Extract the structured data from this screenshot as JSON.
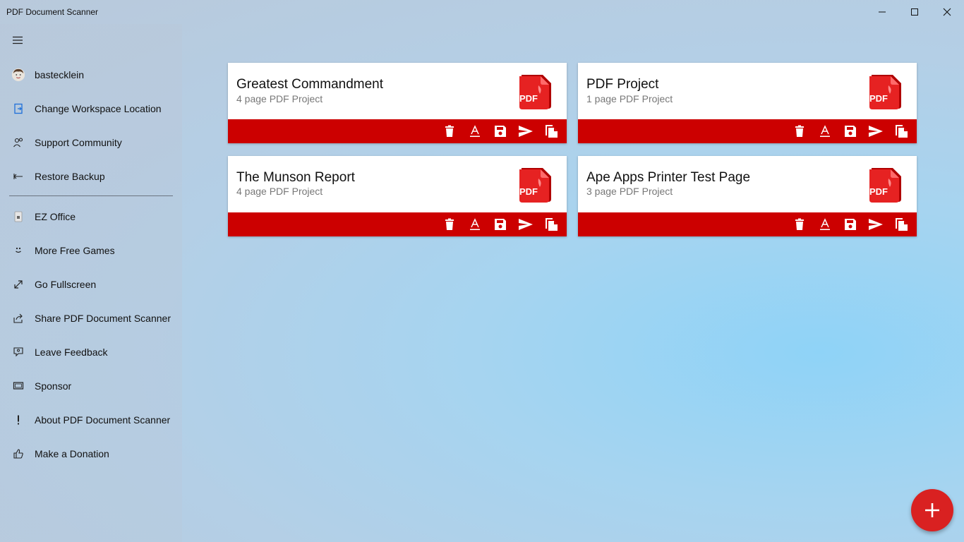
{
  "window": {
    "title": "PDF Document Scanner"
  },
  "sidebar": {
    "items": [
      {
        "label": "bastecklein",
        "icon": "avatar"
      },
      {
        "label": "Change Workspace Location",
        "icon": "folder-icon"
      },
      {
        "label": "Support Community",
        "icon": "community-icon"
      },
      {
        "label": "Restore Backup",
        "icon": "restore-icon"
      },
      {
        "label": "EZ Office",
        "icon": "ez-office-icon"
      },
      {
        "label": "More Free Games",
        "icon": "smiley-icon"
      },
      {
        "label": "Go Fullscreen",
        "icon": "fullscreen-icon"
      },
      {
        "label": "Share PDF Document Scanner",
        "icon": "share-icon"
      },
      {
        "label": "Leave Feedback",
        "icon": "feedback-icon"
      },
      {
        "label": "Sponsor",
        "icon": "sponsor-icon"
      },
      {
        "label": "About PDF Document Scanner",
        "icon": "info-icon"
      },
      {
        "label": "Make a Donation",
        "icon": "thumbs-up-icon"
      }
    ]
  },
  "projects": [
    {
      "title": "Greatest Commandment",
      "subtitle": "4 page PDF Project",
      "logo_text": "PDF"
    },
    {
      "title": "PDF Project",
      "subtitle": "1 page PDF Project",
      "logo_text": "PDF"
    },
    {
      "title": "The Munson Report",
      "subtitle": "4 page PDF Project",
      "logo_text": "PDF"
    },
    {
      "title": "Ape Apps Printer Test Page",
      "subtitle": "3 page PDF Project",
      "logo_text": "PDF"
    }
  ],
  "colors": {
    "accent_red": "#cc0000",
    "fab_red": "#d92121"
  }
}
